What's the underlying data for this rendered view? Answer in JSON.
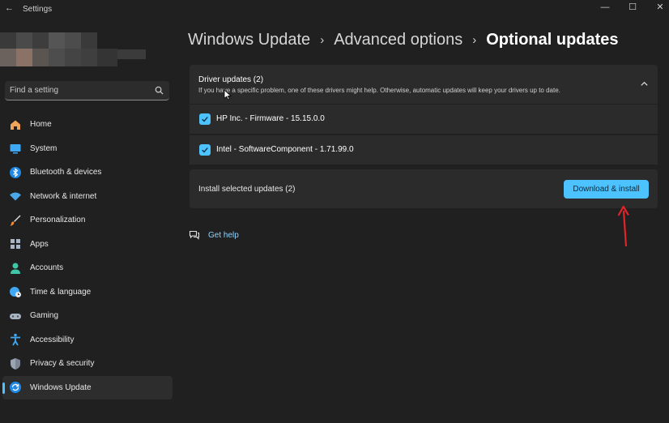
{
  "window": {
    "back_glyph": "←",
    "title": "Settings",
    "minimize_glyph": "—",
    "maximize_glyph": "☐",
    "close_glyph": "✕"
  },
  "search": {
    "placeholder": "Find a setting",
    "icon": "search-icon"
  },
  "sidebar": {
    "items": [
      {
        "label": "Home",
        "icon": "home-icon"
      },
      {
        "label": "System",
        "icon": "system-icon"
      },
      {
        "label": "Bluetooth & devices",
        "icon": "bluetooth-icon"
      },
      {
        "label": "Network & internet",
        "icon": "network-icon"
      },
      {
        "label": "Personalization",
        "icon": "brush-icon"
      },
      {
        "label": "Apps",
        "icon": "apps-icon"
      },
      {
        "label": "Accounts",
        "icon": "accounts-icon"
      },
      {
        "label": "Time & language",
        "icon": "globe-clock-icon"
      },
      {
        "label": "Gaming",
        "icon": "gamepad-icon"
      },
      {
        "label": "Accessibility",
        "icon": "accessibility-icon"
      },
      {
        "label": "Privacy & security",
        "icon": "shield-icon"
      },
      {
        "label": "Windows Update",
        "icon": "update-icon",
        "active": true
      }
    ]
  },
  "breadcrumb": {
    "items": [
      "Windows Update",
      "Advanced options"
    ],
    "separator": "›",
    "current": "Optional updates"
  },
  "driver_updates": {
    "title": "Driver updates (2)",
    "description": "If you have a specific problem, one of these drivers might help. Otherwise, automatic updates will keep your drivers up to date.",
    "expanded": true,
    "items": [
      {
        "label": "HP Inc. - Firmware - 15.15.0.0",
        "checked": true
      },
      {
        "label": "Intel - SoftwareComponent - 1.71.99.0",
        "checked": true
      }
    ]
  },
  "install": {
    "label": "Install selected updates (2)",
    "button_label": "Download & install"
  },
  "help": {
    "label": "Get help"
  },
  "colors": {
    "accent": "#4cc2ff",
    "background": "#202020",
    "card": "#2b2b2b",
    "annotation_arrow": "#e0242a"
  }
}
